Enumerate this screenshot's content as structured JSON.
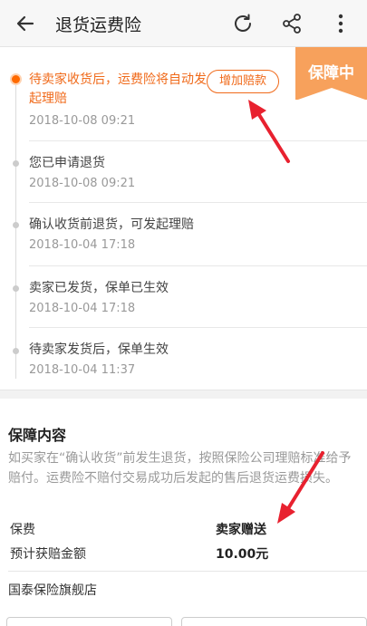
{
  "header": {
    "title": "退货运费险",
    "back_icon": "arrow-left-icon",
    "refresh_icon": "refresh-icon",
    "share_icon": "share-icon",
    "more_icon": "more-vertical-icon"
  },
  "status_tag": "保障中",
  "timeline": [
    {
      "title": "待卖家收货后，运费险将自动发起理赔",
      "time": "2018-10-08 09:21",
      "active": true
    },
    {
      "title": "您已申请退货",
      "time": "2018-10-08 09:21"
    },
    {
      "title": "确认收货前退货，可发起理赔",
      "time": "2018-10-04 17:18"
    },
    {
      "title": "卖家已发货，保单已生效",
      "time": "2018-10-04 17:18"
    },
    {
      "title": "待卖家发货后，保单生效",
      "time": "2018-10-04 11:37"
    }
  ],
  "claim_button": "增加赔款",
  "coverage": {
    "title": "保障内容",
    "description": "如买家在“确认收货”前发生退货，按照保险公司理赔标准给予赔付。运费险不赔付交易成功后发起的售后退货运费损失。",
    "premium_label": "保费",
    "premium_value": "卖家赠送",
    "payout_label": "预计获赔金额",
    "payout_value": "10.00元"
  },
  "store": "国泰保险旗舰店",
  "colors": {
    "accent": "#f06a1a",
    "tag": "#f7a15c",
    "arrow": "#e8212f"
  }
}
